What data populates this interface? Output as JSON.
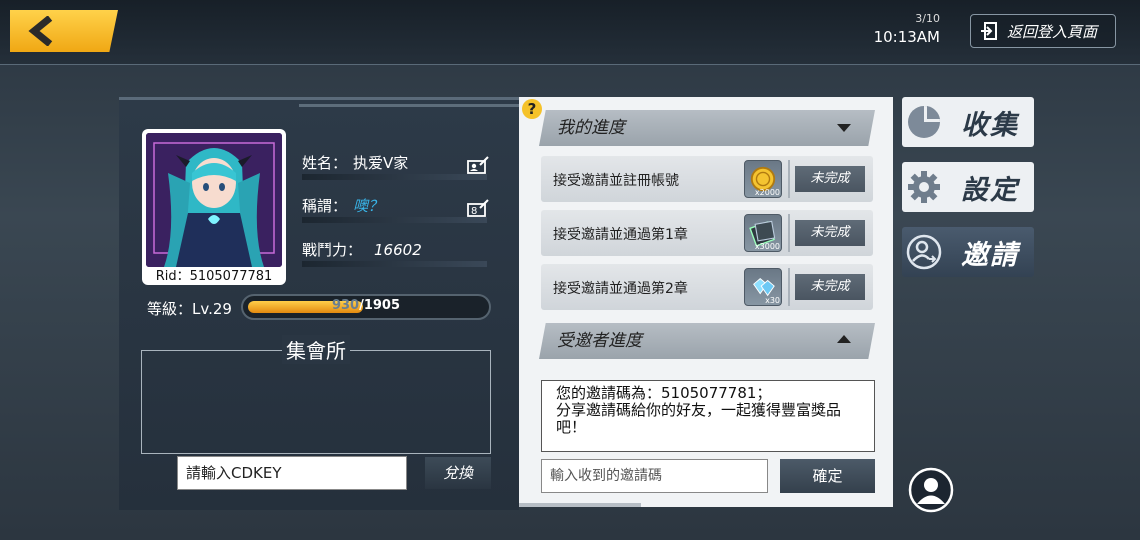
{
  "topbar": {
    "date": "3/10",
    "time": "10:13AM",
    "logout_label": "返回登入頁面"
  },
  "profile": {
    "rid_label": "Rid：5105077781",
    "name_label": "姓名：",
    "name_value": "执爱V家",
    "title_label": "稱謂：",
    "title_value": "噢？",
    "power_label": "戰鬥力：",
    "power_value": "16602",
    "level_label": "等級：Lv.29",
    "exp_current": "930",
    "exp_total": "/1905",
    "exp_fraction": 0.488
  },
  "hall": {
    "title": "集會所",
    "cdkey_placeholder": "請輸入CDKEY",
    "redeem_label": "兌換"
  },
  "progress": {
    "my_progress_header": "我的進度",
    "tasks": [
      {
        "label": "接受邀請並註冊帳號",
        "icon": "gold-coin-icon",
        "qty": "x2000",
        "status": "未完成"
      },
      {
        "label": "接受邀請並通過第1章",
        "icon": "ticket-icon",
        "qty": "x3000",
        "status": "未完成"
      },
      {
        "label": "接受邀請並通過第2章",
        "icon": "crystal-icon",
        "qty": "x30",
        "status": "未完成"
      }
    ],
    "invitee_header": "受邀者進度",
    "invite_message": "您的邀請碼為：5105077781；\n分享邀請碼給你的好友，一起獲得豐富獎品吧！",
    "invite_input_placeholder": "輸入收到的邀請碼",
    "confirm_label": "確定"
  },
  "side_menu": {
    "collect_label": "收集",
    "settings_label": "設定",
    "invite_label": "邀請"
  },
  "colors": {
    "accent_yellow": "#f5b821",
    "panel_dark": "#2d3a48",
    "panel_light": "#f1f3f5"
  }
}
